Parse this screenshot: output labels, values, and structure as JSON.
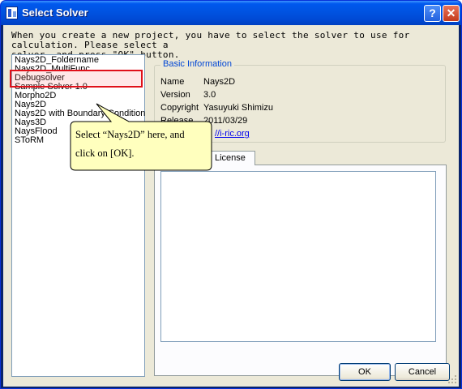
{
  "window": {
    "title": "Select Solver",
    "help_glyph": "?",
    "close_glyph": "✕"
  },
  "intro": {
    "line1": "When you create a new project, you have to select the solver to use for calculation. Please select a",
    "line2": "solver, and press \"OK\" button."
  },
  "solver_list": {
    "items": [
      "Nays2D_Foldername",
      "Nays2D_MultiFunc",
      "Debugsolver",
      "Sample Solver 1.0",
      "Morpho2D",
      "Nays2D",
      "Nays2D with Boundary Condition",
      "Nays3D",
      "NaysFlood",
      "SToRM"
    ],
    "selected": "Nays2D"
  },
  "basic_info": {
    "title": "Basic Information",
    "rows": [
      {
        "label": "Name",
        "value": "Nays2D"
      },
      {
        "label": "Version",
        "value": "3.0"
      },
      {
        "label": "Copyright",
        "value": "Yasuyuki Shimizu"
      },
      {
        "label": "Release",
        "value": "2011/03/29"
      }
    ],
    "link_fragment": "//i-ric.org"
  },
  "tabs": {
    "license_label": "License"
  },
  "callout": {
    "line1": "Select “Nays2D” here,  and",
    "line2": "click on [OK]."
  },
  "buttons": {
    "ok": "OK",
    "cancel": "Cancel"
  },
  "colors": {
    "titlebar": "#0054e3",
    "highlight_border": "#e0101a",
    "callout_fill": "#ffffbe",
    "group_title": "#0046d5"
  },
  "icons": {
    "app": "app-icon",
    "help": "help-icon",
    "close": "close-icon",
    "grip": "resize-grip-icon"
  }
}
